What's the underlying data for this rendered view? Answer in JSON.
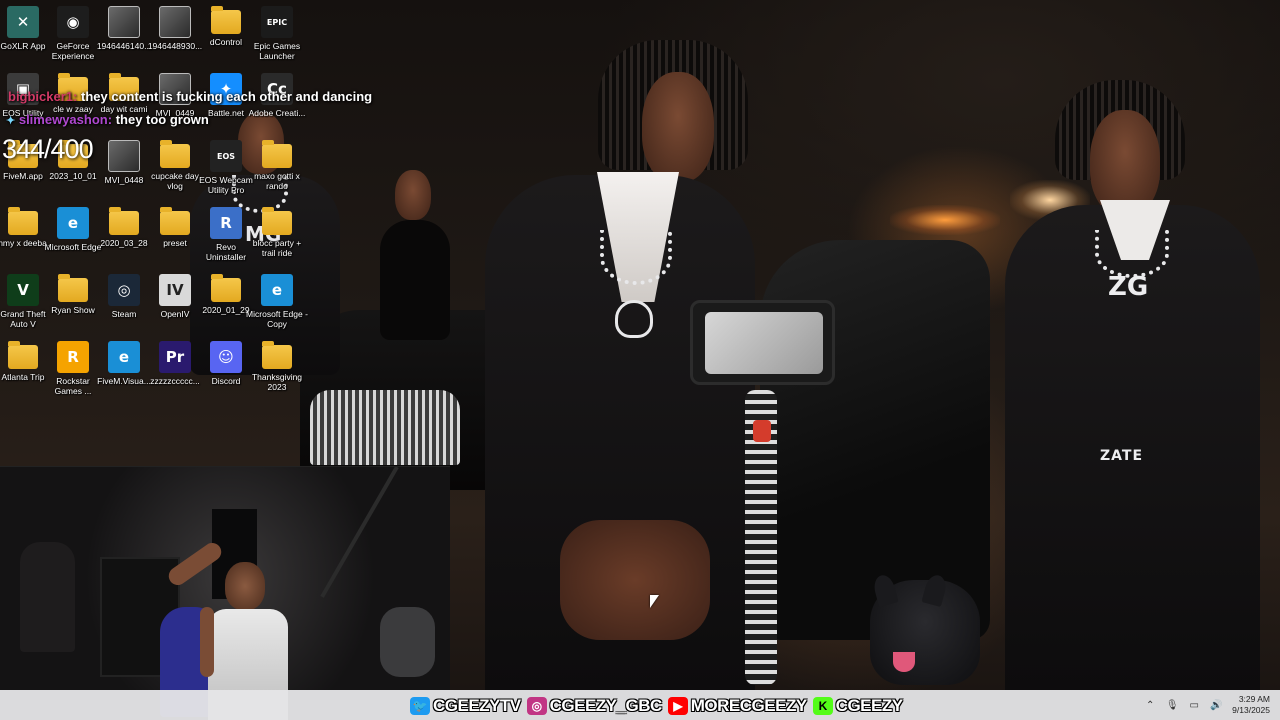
{
  "desktop_icons": [
    {
      "label": "GoXLR App",
      "icon": "goxlr-icon",
      "type": "app",
      "bg": "#2a6a63",
      "glyph": "✕"
    },
    {
      "label": "GeForce Experience",
      "icon": "geforce-icon",
      "type": "app",
      "bg": "#1d1d1d",
      "glyph": "◉"
    },
    {
      "label": "1946446140...",
      "icon": "image-file-icon",
      "type": "thumb"
    },
    {
      "label": "1946448930...",
      "icon": "image-file-icon",
      "type": "thumb"
    },
    {
      "label": "dControl",
      "icon": "folder-icon",
      "type": "folder"
    },
    {
      "label": "Epic Games Launcher",
      "icon": "epic-games-icon",
      "type": "app",
      "bg": "#1b1b1b",
      "glyph": "EPIC"
    },
    {
      "label": "EOS Utility",
      "icon": "eos-utility-icon",
      "type": "app",
      "bg": "#3b3b3b",
      "glyph": "▣"
    },
    {
      "label": "cle w zaay",
      "icon": "folder-icon",
      "type": "folder"
    },
    {
      "label": "day wit cami",
      "icon": "folder-icon",
      "type": "folder"
    },
    {
      "label": "MVI_0449",
      "icon": "video-file-icon",
      "type": "thumb"
    },
    {
      "label": "Battle.net",
      "icon": "battlenet-icon",
      "type": "app",
      "bg": "#148eff",
      "glyph": "✦"
    },
    {
      "label": "Adobe Creati...",
      "icon": "adobe-cc-icon",
      "type": "app",
      "bg": "#2a2a2a",
      "glyph": "Cc"
    },
    {
      "label": "FiveM.app",
      "icon": "folder-icon",
      "type": "folder"
    },
    {
      "label": "2023_10_01",
      "icon": "folder-icon",
      "type": "folder"
    },
    {
      "label": "MVI_0448",
      "icon": "video-file-icon",
      "type": "thumb"
    },
    {
      "label": "cupcake day vlog",
      "icon": "folder-icon",
      "type": "folder"
    },
    {
      "label": "EOS Webcam Utility Pro",
      "icon": "eos-webcam-icon",
      "type": "app",
      "bg": "#222",
      "glyph": "EOS"
    },
    {
      "label": "maxo gotti x rando",
      "icon": "folder-icon",
      "type": "folder"
    },
    {
      "label": "jimmy x deeba...",
      "icon": "folder-icon",
      "type": "folder"
    },
    {
      "label": "Microsoft Edge",
      "icon": "edge-icon",
      "type": "app",
      "bg": "#1a8fd6",
      "glyph": "e"
    },
    {
      "label": "2020_03_28",
      "icon": "folder-icon",
      "type": "folder"
    },
    {
      "label": "preset",
      "icon": "folder-icon",
      "type": "folder"
    },
    {
      "label": "Revo Uninstaller",
      "icon": "revo-icon",
      "type": "app",
      "bg": "#3b6fc8",
      "glyph": "R"
    },
    {
      "label": "blocc party + trail ride",
      "icon": "folder-icon",
      "type": "folder"
    },
    {
      "label": "Grand Theft Auto V",
      "icon": "gta-icon",
      "type": "app",
      "bg": "#0f3d1a",
      "glyph": "V"
    },
    {
      "label": "Ryan Show",
      "icon": "folder-icon",
      "type": "folder"
    },
    {
      "label": "Steam",
      "icon": "steam-icon",
      "type": "app",
      "bg": "#1b2838",
      "glyph": "◎"
    },
    {
      "label": "OpenIV",
      "icon": "openiv-icon",
      "type": "app",
      "bg": "#d9d9d9",
      "glyph": "IV"
    },
    {
      "label": "2020_01_29",
      "icon": "folder-icon",
      "type": "folder"
    },
    {
      "label": "Microsoft Edge - Copy",
      "icon": "edge-icon",
      "type": "app",
      "bg": "#1a8fd6",
      "glyph": "e"
    },
    {
      "label": "Atlanta Trip",
      "icon": "folder-icon",
      "type": "folder"
    },
    {
      "label": "Rockstar Games ...",
      "icon": "rockstar-icon",
      "type": "app",
      "bg": "#f5a300",
      "glyph": "R"
    },
    {
      "label": "FiveM.Visua...",
      "icon": "edge-icon",
      "type": "app",
      "bg": "#1a8fd6",
      "glyph": "e"
    },
    {
      "label": "zzzzzccccc...",
      "icon": "premiere-project-icon",
      "type": "app",
      "bg": "#2a1a6e",
      "glyph": "Pr"
    },
    {
      "label": "Discord",
      "icon": "discord-icon",
      "type": "app",
      "bg": "#5865f2",
      "glyph": "☺"
    },
    {
      "label": "Thanksgiving 2023",
      "icon": "folder-icon",
      "type": "folder"
    }
  ],
  "chat": [
    {
      "user": "bigbicker1",
      "message": "they content is fucking each other and dancing"
    },
    {
      "user": "slimewyashon",
      "message": "they too grown"
    }
  ],
  "counter": "344/400",
  "wallpaper": {
    "chain_left": "MG",
    "chain_right": "ZG",
    "belt": "ZATE"
  },
  "socials": [
    {
      "platform": "twitter-icon",
      "handle": "CGEEZYTV",
      "color": "#1d9bf0",
      "glyph": "🐦"
    },
    {
      "platform": "instagram-icon",
      "handle": "CGEEZY_GBC",
      "color": "#c13584",
      "glyph": "◎"
    },
    {
      "platform": "youtube-icon",
      "handle": "MORECGEEZY",
      "color": "#ff0000",
      "glyph": "▶"
    },
    {
      "platform": "kick-icon",
      "handle": "CGEEZY",
      "color": "#53fc18",
      "glyph": "K"
    }
  ],
  "taskbar": {
    "time": "3:29 AM",
    "date": "9/13/2025"
  }
}
